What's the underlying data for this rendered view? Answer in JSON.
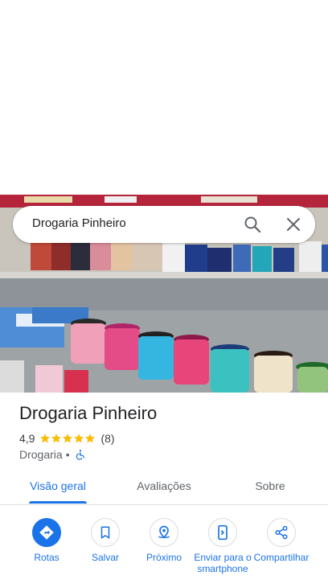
{
  "search": {
    "query": "Drogaria Pinheiro"
  },
  "place": {
    "name": "Drogaria Pinheiro",
    "rating": "4,9",
    "stars": 5,
    "review_count": "(8)",
    "category": "Drogaria",
    "separator": "•"
  },
  "tabs": [
    {
      "label": "Visão geral",
      "active": true
    },
    {
      "label": "Avaliações",
      "active": false
    },
    {
      "label": "Sobre",
      "active": false
    }
  ],
  "actions": [
    {
      "label": "Rotas",
      "icon": "directions-icon"
    },
    {
      "label": "Salvar",
      "icon": "bookmark-icon"
    },
    {
      "label": "Próximo",
      "icon": "nearby-icon"
    },
    {
      "label": "Enviar para o smartphone",
      "icon": "send-to-phone-icon"
    },
    {
      "label": "Compartilhar",
      "icon": "share-icon"
    }
  ],
  "colors": {
    "accent": "#1a73e8",
    "star": "#fbbc04",
    "text": "#202124",
    "secondary": "#5f6368"
  }
}
